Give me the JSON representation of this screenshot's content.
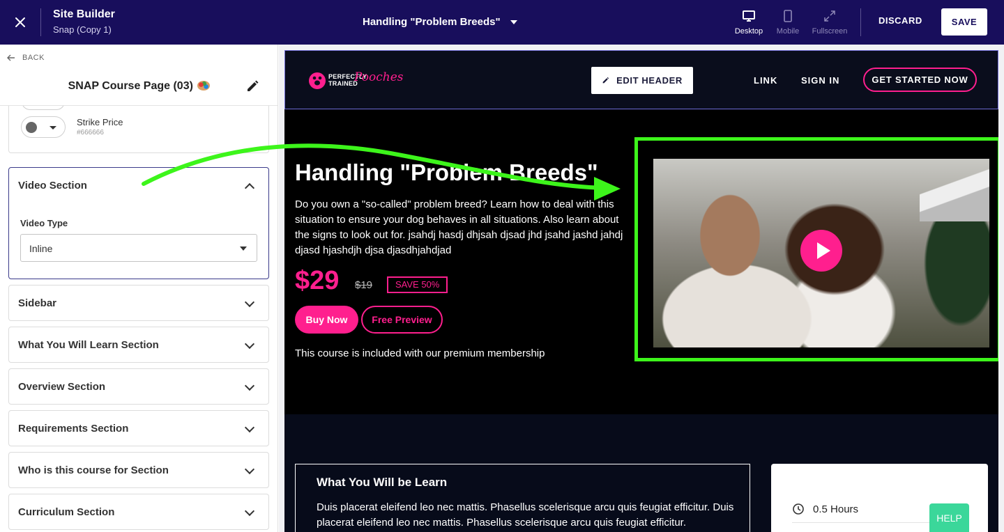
{
  "topbar": {
    "app_title": "Site Builder",
    "app_subtitle": "Snap (Copy 1)",
    "page_name": "Handling \"Problem Breeds\"",
    "views": [
      {
        "label": "Desktop",
        "active": true
      },
      {
        "label": "Mobile",
        "active": false
      },
      {
        "label": "Fullscreen",
        "active": false
      }
    ],
    "discard_label": "DISCARD",
    "save_label": "SAVE",
    "bg_color": "#180e5c"
  },
  "left_panel": {
    "back_label": "BACK",
    "title": "SNAP Course Page (03)",
    "title_icon": "artist-palette-emoji",
    "color_item": {
      "name": "Strike Price",
      "hex": "#666666"
    },
    "open_section": {
      "name": "Video Section",
      "field_label": "Video Type",
      "field_value": "Inline"
    },
    "sections": [
      "Sidebar",
      "What You Will Learn Section",
      "Overview Section",
      "Requirements Section",
      "Who is this course for Section",
      "Curriculum Section"
    ]
  },
  "preview": {
    "header": {
      "logo_text_line1": "PERFECTLY",
      "logo_text_line2": "TRAINED",
      "logo_script": "Pooches",
      "edit_header_label": "EDIT HEADER",
      "nav": [
        "LINK",
        "SIGN IN"
      ],
      "cta_label": "GET STARTED NOW"
    },
    "hero": {
      "title": "Handling \"Problem Breeds\"",
      "description": "Do you own a \"so-called\" problem breed? Learn how to deal with this situation to ensure your dog behaves in all situations. Also learn about the signs to look out for. jsahdj hasdj dhjsah djsad jhd jsahd jashd jahdj djasd hjashdjh djsa djasdhjahdjad",
      "price": "$29",
      "strike_price": "$19",
      "save_badge": "SAVE 50%",
      "buy_label": "Buy Now",
      "preview_label": "Free Preview",
      "membership_note": "This course is included with our premium membership"
    },
    "learn": {
      "title": "What You Will be Learn",
      "text": "Duis placerat eleifend leo nec mattis. Phasellus scelerisque arcu quis feugiat efficitur. Duis placerat eleifend leo nec mattis. Phasellus scelerisque arcu quis feugiat efficitur."
    },
    "info": {
      "duration": "0.5 Hours"
    },
    "accent_color": "#ff1f8e",
    "highlight_color": "#3df51b"
  },
  "help_label": "HELP"
}
